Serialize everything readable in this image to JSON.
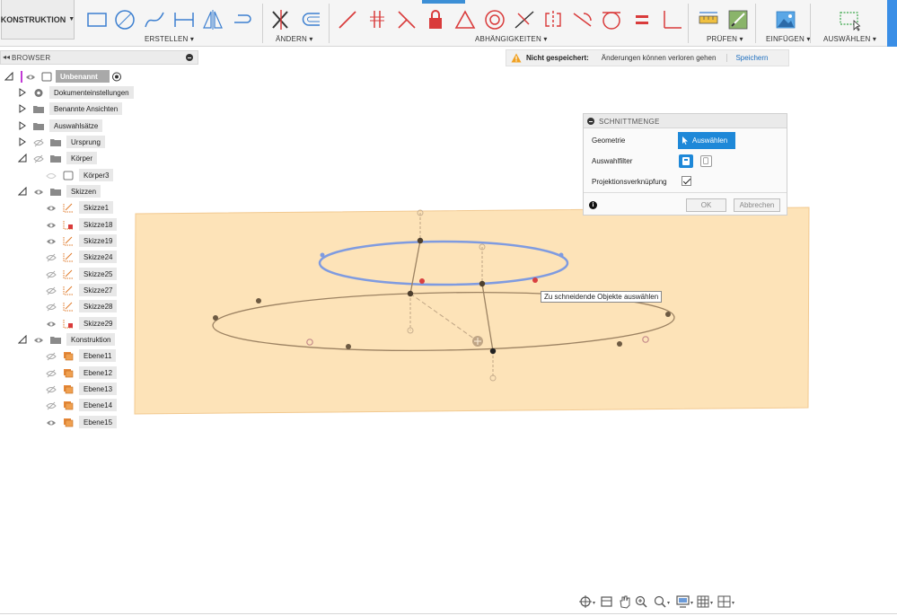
{
  "toolbar": {
    "workspace_label": "KONSTRUKTION",
    "groups": {
      "erstellen": "ERSTELLEN",
      "aendern": "ÄNDERN",
      "abhaengigkeiten": "ABHÄNGIGKEITEN",
      "pruefen": "PRÜFEN",
      "einfuegen": "EINFÜGEN",
      "auswaehlen": "AUSWÄHLEN"
    },
    "colors": {
      "tool_blue": "#3c7fd0",
      "constraint_red": "#d93b3b",
      "active_tab": "#3c8fd6"
    }
  },
  "browser": {
    "title": "BROWSER",
    "root": "Unbenannt",
    "items": [
      {
        "label": "Dokumenteinstellungen"
      },
      {
        "label": "Benannte Ansichten"
      },
      {
        "label": "Auswahlsätze"
      },
      {
        "label": "Ursprung"
      },
      {
        "label": "Körper"
      },
      {
        "label": "Körper3"
      },
      {
        "label": "Skizzen"
      },
      {
        "label": "Skizze1"
      },
      {
        "label": "Skizze18"
      },
      {
        "label": "Skizze19"
      },
      {
        "label": "Skizze24"
      },
      {
        "label": "Skizze25"
      },
      {
        "label": "Skizze27"
      },
      {
        "label": "Skizze28"
      },
      {
        "label": "Skizze29"
      },
      {
        "label": "Konstruktion"
      },
      {
        "label": "Ebene11"
      },
      {
        "label": "Ebene12"
      },
      {
        "label": "Ebene13"
      },
      {
        "label": "Ebene14"
      },
      {
        "label": "Ebene15"
      }
    ]
  },
  "notification": {
    "title": "Nicht gespeichert:",
    "message": "Änderungen können verloren gehen",
    "action": "Speichern"
  },
  "dialog": {
    "title": "SCHNITTMENGE",
    "geometry_label": "Geometrie",
    "select_button": "Auswählen",
    "filter_label": "Auswahlfilter",
    "projection_label": "Projektionsverknüpfung",
    "projection_checked": true,
    "ok": "OK",
    "cancel": "Abbrechen"
  },
  "canvas": {
    "tooltip": "Zu schneidende Objekte auswählen",
    "plane_color": "#fde3b8",
    "highlight_color": "#7f9be0"
  }
}
